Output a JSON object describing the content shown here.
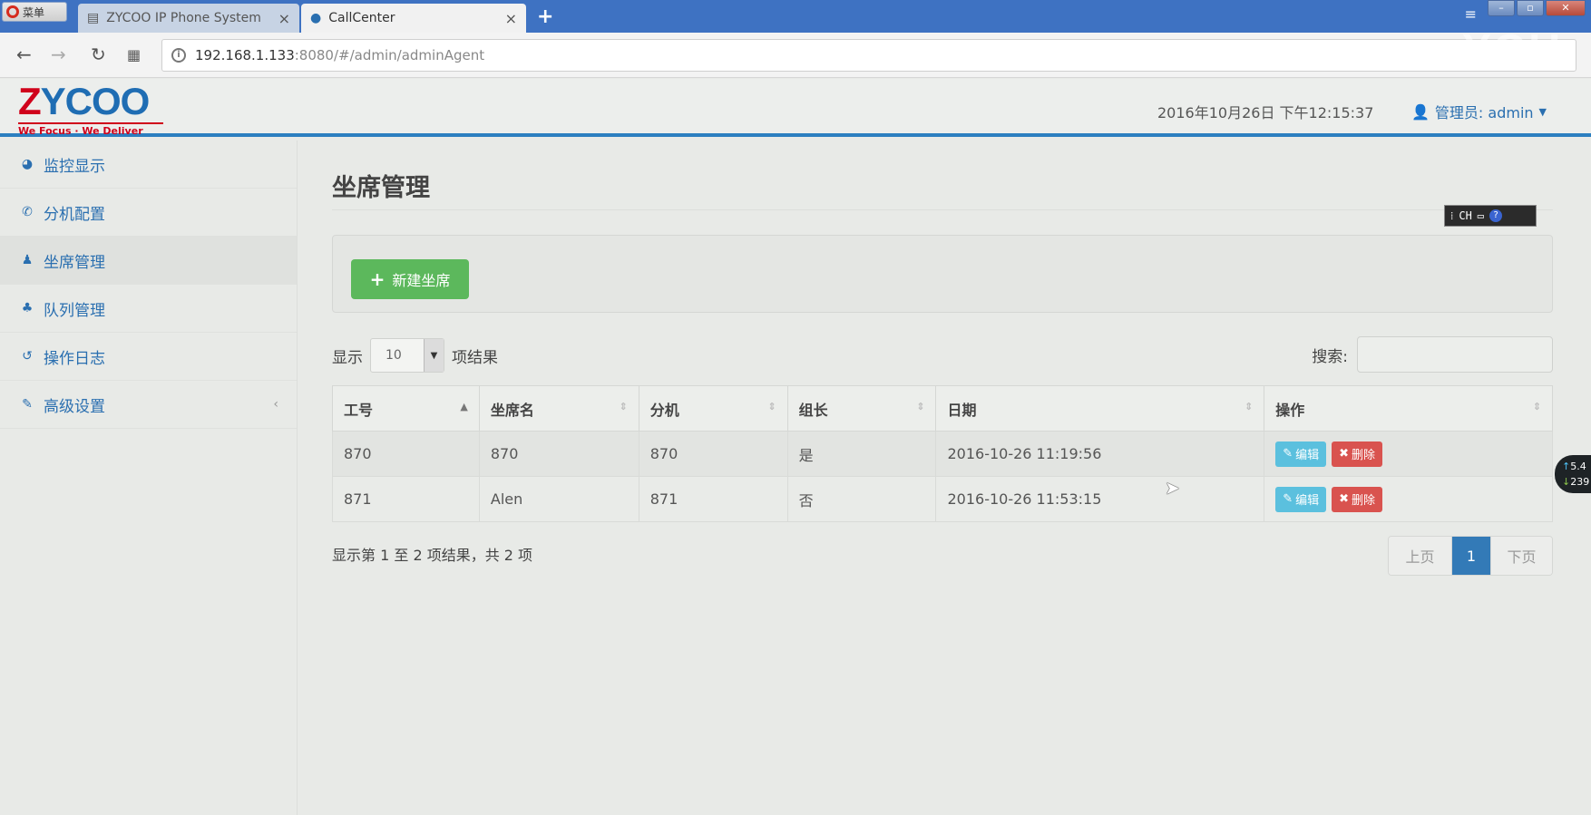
{
  "browser": {
    "menu_label": "菜单",
    "tabs": [
      {
        "title": "ZYCOO IP Phone System",
        "close": "×"
      },
      {
        "title": "CallCenter",
        "close": "×"
      }
    ],
    "new_tab": "+",
    "url_host": "192.168.1.133",
    "url_rest": ":8080/#/admin/adminAgent",
    "watermark": "YOU"
  },
  "header": {
    "logo_text_1": "Z",
    "logo_text_2": "YCOO",
    "logo_tagline": "We Focus · We Deliver",
    "datetime": "2016年10月26日 下午12:15:37",
    "user_label": "管理员: admin"
  },
  "sidebar": {
    "items": [
      {
        "label": "监控显示",
        "icon": "dashboard-icon"
      },
      {
        "label": "分机配置",
        "icon": "phone-icon"
      },
      {
        "label": "坐席管理",
        "icon": "user-icon"
      },
      {
        "label": "队列管理",
        "icon": "users-icon"
      },
      {
        "label": "操作日志",
        "icon": "history-icon"
      },
      {
        "label": "高级设置",
        "icon": "wrench-icon"
      }
    ]
  },
  "main": {
    "page_title": "坐席管理",
    "new_button": "新建坐席",
    "length_prefix": "显示",
    "length_value": "10",
    "length_suffix": "项结果",
    "search_label": "搜索:",
    "columns": [
      "工号",
      "坐席名",
      "分机",
      "组长",
      "日期",
      "操作"
    ],
    "rows": [
      {
        "id": "870",
        "name": "870",
        "ext": "870",
        "leader": "是",
        "date": "2016-10-26 11:19:56"
      },
      {
        "id": "871",
        "name": "Alen",
        "ext": "871",
        "leader": "否",
        "date": "2016-10-26 11:53:15"
      }
    ],
    "edit_label": "编辑",
    "delete_label": "删除",
    "info": "显示第 1 至 2 项结果，共 2 项",
    "pager": {
      "prev": "上页",
      "current": "1",
      "next": "下页"
    }
  },
  "overlays": {
    "ime_text": "CH",
    "net_up": "5.4",
    "net_down": "239"
  },
  "colors": {
    "primary": "#337ab7",
    "success": "#5cb85c",
    "info": "#5bc0de",
    "danger": "#d9534f",
    "header_rule": "#2c7fc0"
  }
}
